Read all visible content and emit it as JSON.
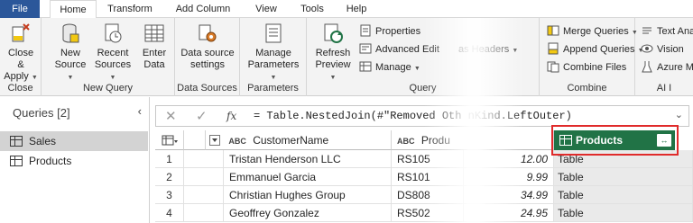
{
  "menu": {
    "tabs": [
      "File",
      "Home",
      "Transform",
      "Add Column",
      "View",
      "Tools",
      "Help"
    ]
  },
  "ribbon": {
    "close_group": {
      "label": "Close",
      "close_apply": "Close &",
      "close_apply2": "Apply"
    },
    "new_query_group": {
      "label": "New Query",
      "new_source": "New",
      "new_source2": "Source",
      "recent_sources": "Recent",
      "recent_sources2": "Sources",
      "enter_data": "Enter",
      "enter_data2": "Data"
    },
    "data_sources_group": {
      "label": "Data Sources",
      "settings": "Data source",
      "settings2": "settings"
    },
    "parameters_group": {
      "label": "Parameters",
      "manage": "Manage",
      "manage2": "Parameters"
    },
    "query_group": {
      "label": "Query",
      "refresh": "Refresh",
      "refresh2": "Preview",
      "properties": "Properties",
      "advanced_editor": "Advanced Edit",
      "manage": "Manage",
      "headers": "as Headers"
    },
    "combine_group": {
      "label": "Combine",
      "merge": "Merge Queries",
      "append": "Append Queries",
      "combine_files": "Combine Files"
    },
    "ai_group": {
      "label": "AI I",
      "text_analytics": "Text Ana",
      "vision": "Vision",
      "azure_ml": "Azure M"
    }
  },
  "queries": {
    "header": "Queries [2]",
    "items": [
      "Sales",
      "Products"
    ]
  },
  "formula": {
    "text": "= Table.NestedJoin(#\"Removed Oth       nKind.LeftOuter)"
  },
  "grid": {
    "headers": {
      "customer_type": "ABC",
      "customer": "CustomerName",
      "product_type": "ABC",
      "product": "Produ",
      "products": "Products"
    },
    "rows": [
      {
        "n": "1",
        "customer": "Tristan Henderson LLC",
        "product": "RS105",
        "value": "12.00",
        "table": "Table"
      },
      {
        "n": "2",
        "customer": "Emmanuel Garcia",
        "product": "RS101",
        "value": "9.99",
        "table": "Table"
      },
      {
        "n": "3",
        "customer": "Christian Hughes Group",
        "product": "DS808",
        "value": "34.99",
        "table": "Table"
      },
      {
        "n": "4",
        "customer": "Geoffrey Gonzalez",
        "product": "RS502",
        "value": "24.95",
        "table": "Table"
      }
    ]
  },
  "colors": {
    "file_tab": "#2b579a",
    "products_header": "#217346",
    "highlight": "#e02b2b"
  }
}
